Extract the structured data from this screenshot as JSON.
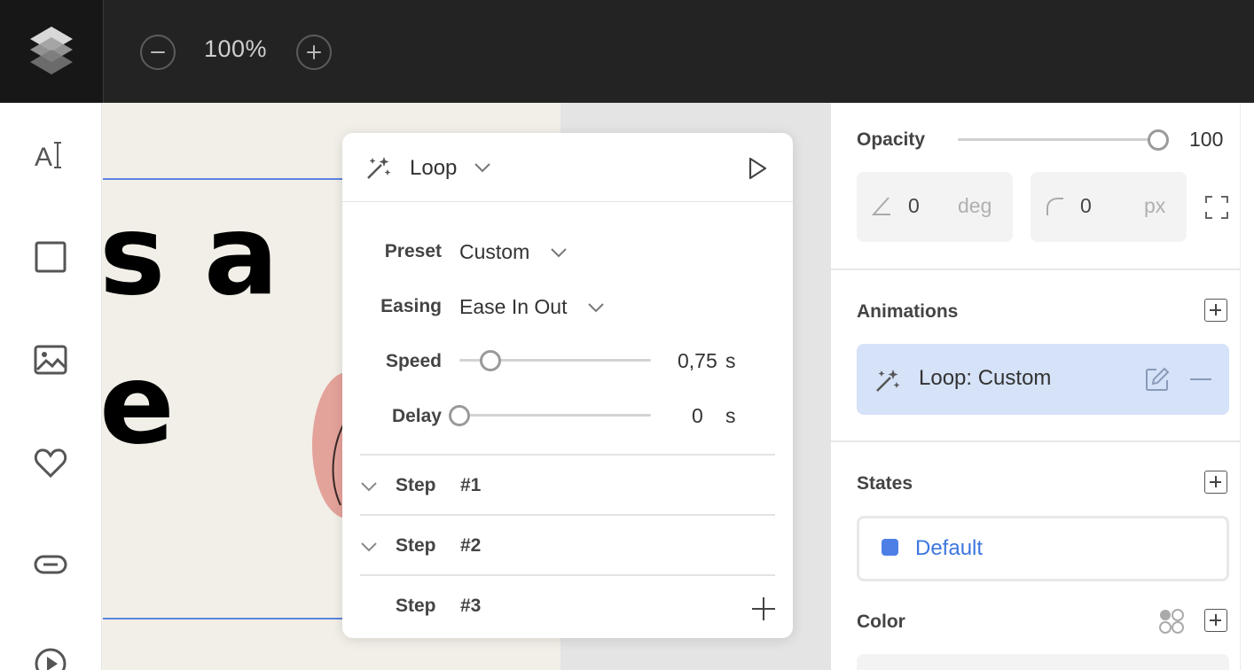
{
  "topbar": {
    "zoom_value": "100%"
  },
  "toolbar": {
    "items": [
      "text-tool",
      "rectangle-tool",
      "image-tool",
      "heart-tool",
      "button-tool",
      "video-tool"
    ]
  },
  "canvas": {
    "line1": "s a",
    "line2": "e"
  },
  "animation_popup": {
    "title": "Loop",
    "preset_label": "Preset",
    "preset_value": "Custom",
    "easing_label": "Easing",
    "easing_value": "Ease In Out",
    "speed_label": "Speed",
    "speed_value": "0,75",
    "speed_unit": "s",
    "speed_fraction": 0.16,
    "delay_label": "Delay",
    "delay_value": "0",
    "delay_unit": "s",
    "delay_fraction": 0.0,
    "steps": [
      {
        "label": "Step",
        "number": "#1"
      },
      {
        "label": "Step",
        "number": "#2"
      },
      {
        "label": "Step",
        "number": "#3"
      }
    ]
  },
  "properties": {
    "opacity_label": "Opacity",
    "opacity_value": "100",
    "opacity_fraction": 1.0,
    "rotation_value": "0",
    "rotation_unit": "deg",
    "radius_value": "0",
    "radius_unit": "px",
    "animations_label": "Animations",
    "animation_item": "Loop: Custom",
    "states_label": "States",
    "state_item": "Default",
    "color_label": "Color"
  },
  "colors": {
    "accent": "#3d76de",
    "state_dot": "#4e7fe6",
    "animation_card": "#d5e2f8",
    "topbar": "#232323",
    "canvas": "#f1efe7"
  }
}
